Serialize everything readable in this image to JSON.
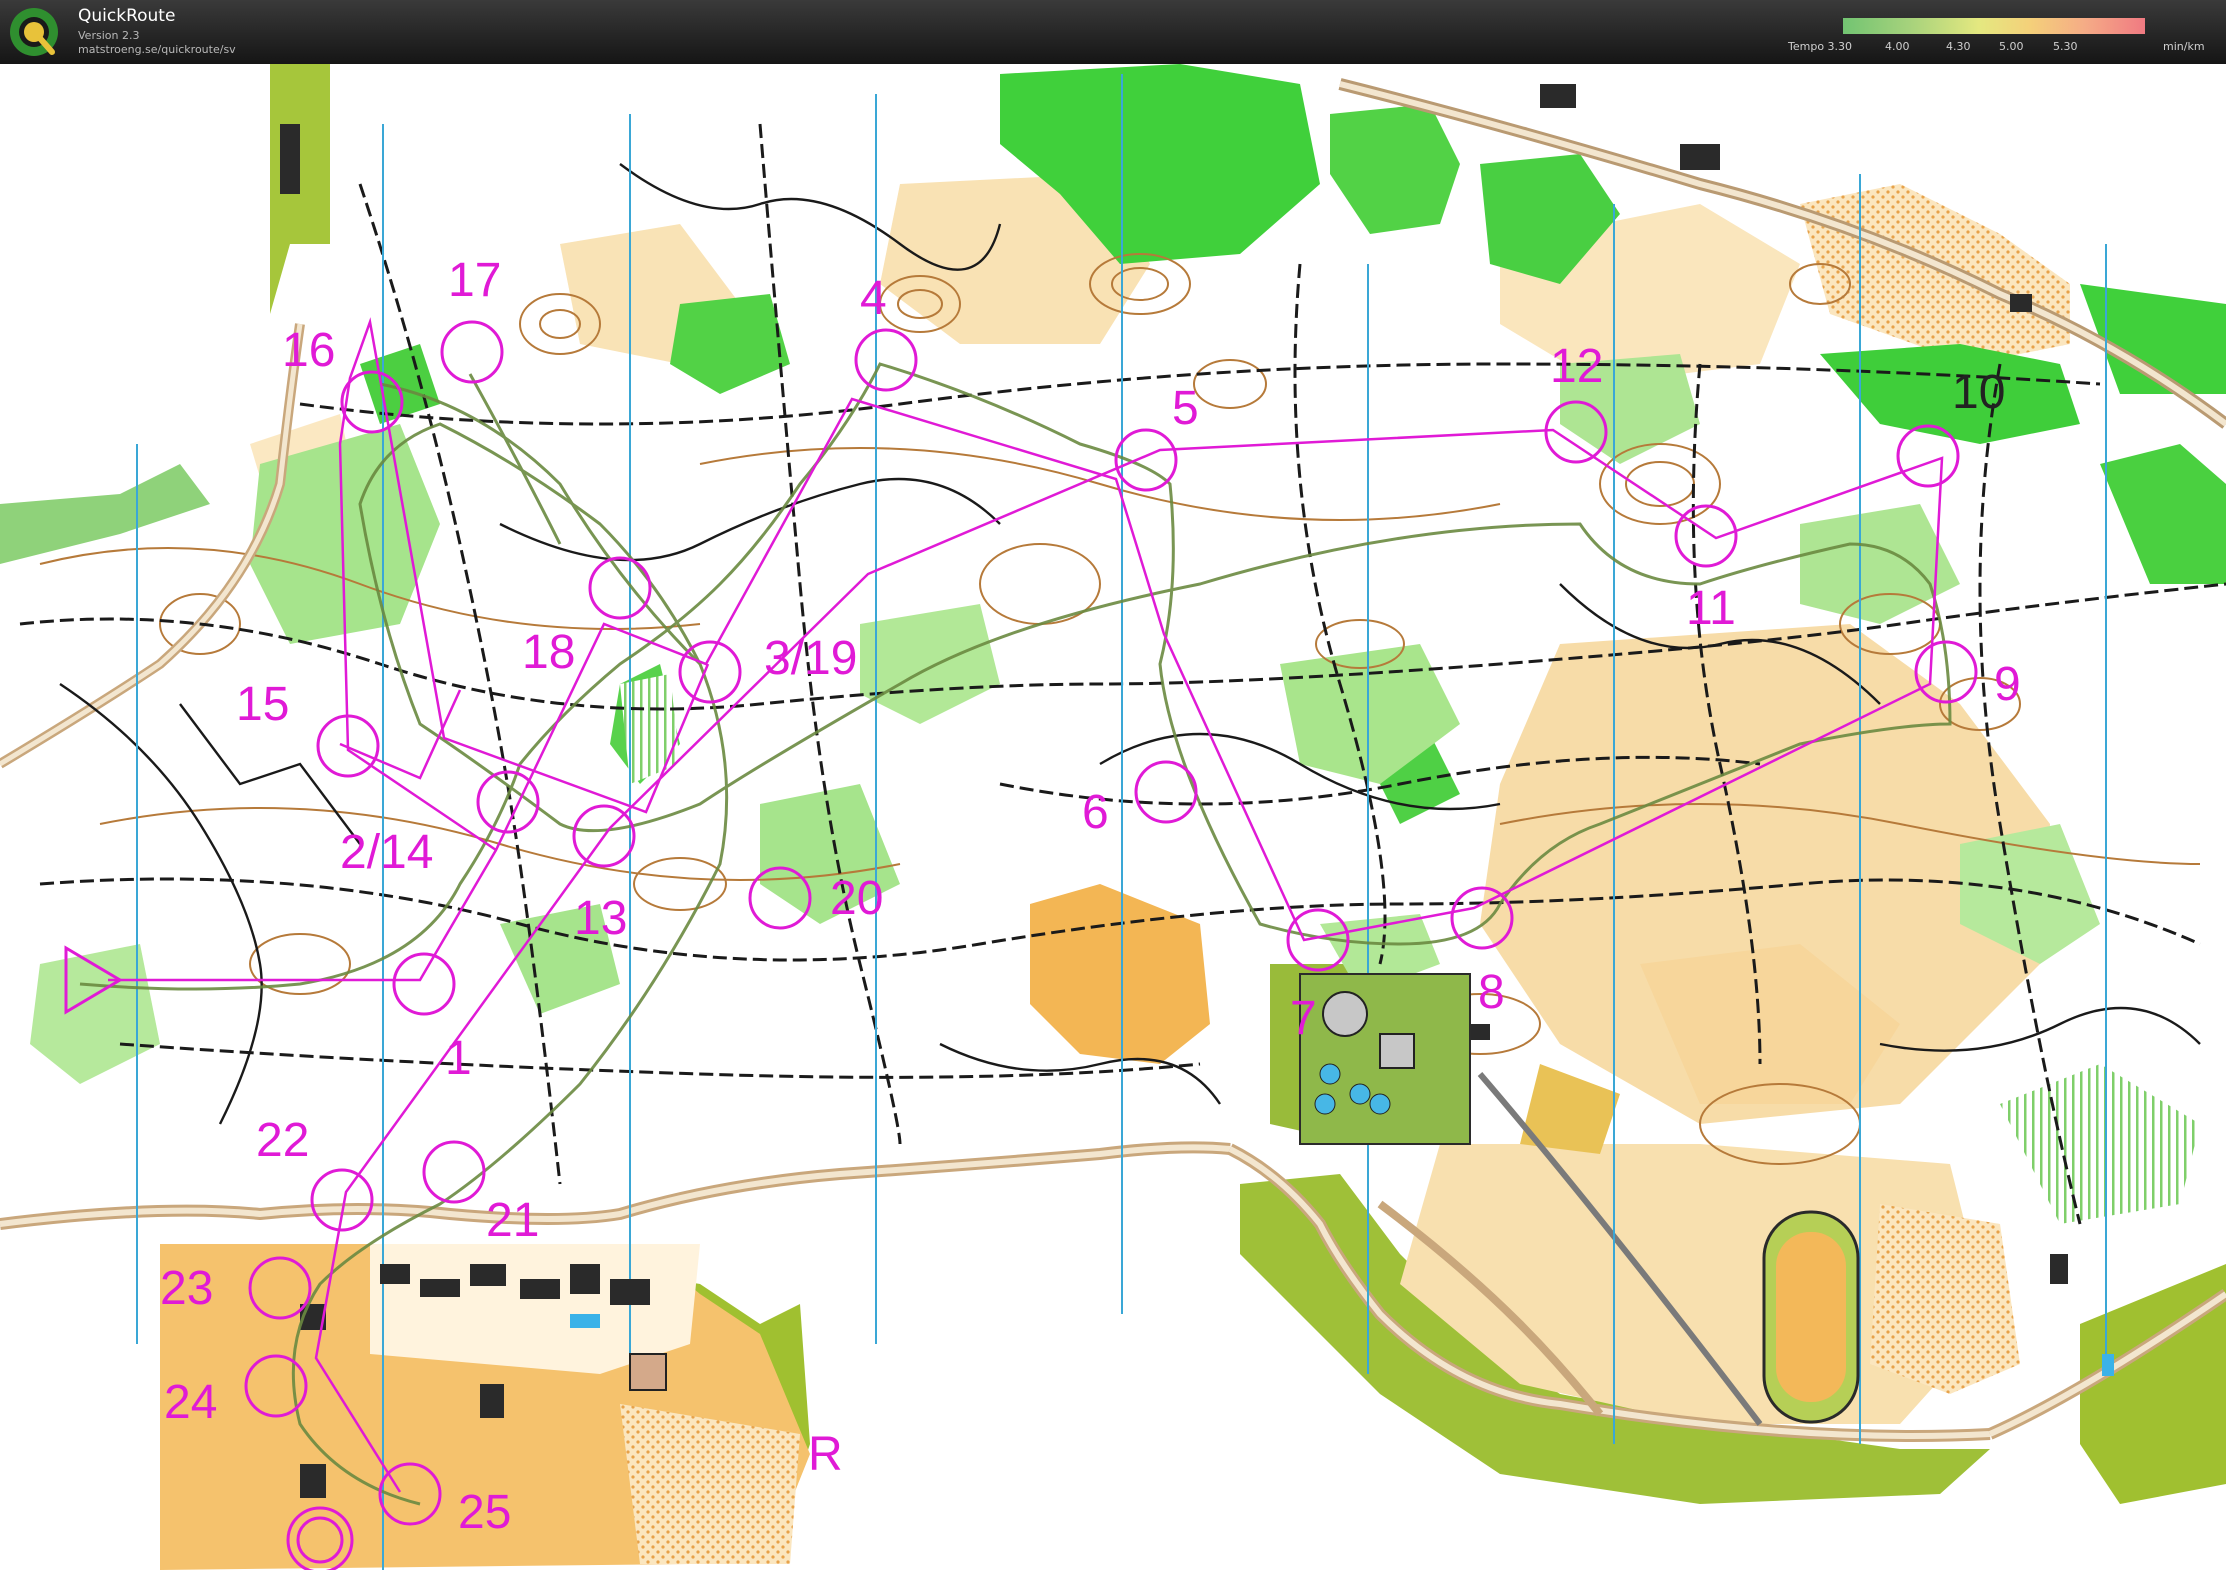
{
  "app": {
    "title": "QuickRoute",
    "version": "Version 2.3",
    "url": "matstroeng.se/quickroute/sv"
  },
  "legend": {
    "ticks": [
      "Tempo 3.30",
      "4.00",
      "4.30",
      "5.00",
      "5.30"
    ],
    "unit": "min/km"
  },
  "colors": {
    "course": "#e01ad6",
    "route": "#6a8a40",
    "forest_green": "#3fd23c",
    "light_green": "#9ee27f",
    "open_land": "#f3cf8c",
    "contour": "#b67a3a",
    "road": "#c9a77c",
    "outside": "#a0c030"
  },
  "controls": [
    {
      "label": "1"
    },
    {
      "label": "2/14"
    },
    {
      "label": "3/19"
    },
    {
      "label": "4"
    },
    {
      "label": "5"
    },
    {
      "label": "6"
    },
    {
      "label": "7"
    },
    {
      "label": "8"
    },
    {
      "label": "9"
    },
    {
      "label": "10"
    },
    {
      "label": "11"
    },
    {
      "label": "12"
    },
    {
      "label": "13"
    },
    {
      "label": "15"
    },
    {
      "label": "16"
    },
    {
      "label": "17"
    },
    {
      "label": "18"
    },
    {
      "label": "20"
    },
    {
      "label": "21"
    },
    {
      "label": "22"
    },
    {
      "label": "23"
    },
    {
      "label": "24"
    },
    {
      "label": "25"
    },
    {
      "label": "R"
    }
  ]
}
